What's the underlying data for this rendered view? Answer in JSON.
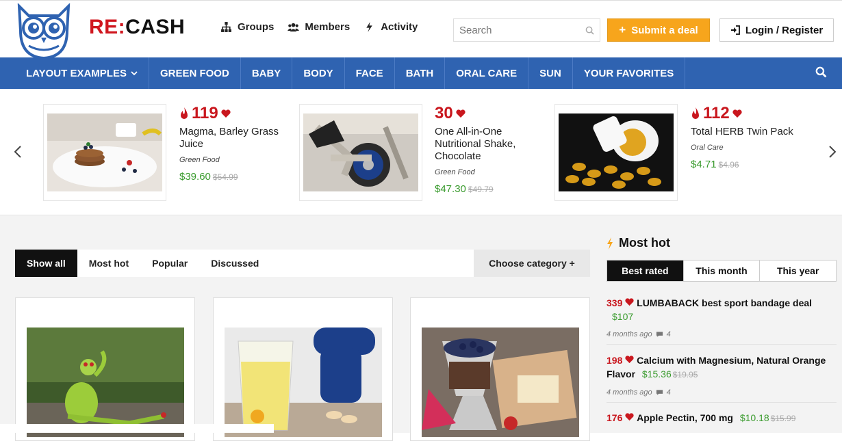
{
  "brand": {
    "re": "RE:",
    "cash": "CASH"
  },
  "topnav": [
    {
      "label": "Groups",
      "icon": "sitemap-icon"
    },
    {
      "label": "Members",
      "icon": "users-icon"
    },
    {
      "label": "Activity",
      "icon": "bolt-icon"
    }
  ],
  "search": {
    "placeholder": "Search"
  },
  "submit_label": "Submit a deal",
  "login_label": "Login / Register",
  "categories": [
    "LAYOUT EXAMPLES",
    "GREEN FOOD",
    "BABY",
    "BODY",
    "FACE",
    "BATH",
    "ORAL CARE",
    "SUN",
    "YOUR FAVORITES"
  ],
  "carousel": [
    {
      "score": "119",
      "name": "Magma, Barley Grass Juice",
      "category": "Green Food",
      "price": "$39.60",
      "old_price": "$54.99",
      "hot": true
    },
    {
      "score": "30",
      "name": "One All-in-One Nutritional Shake, Chocolate",
      "category": "Green Food",
      "price": "$47.30",
      "old_price": "$49.79",
      "hot": false
    },
    {
      "score": "112",
      "name": "Total HERB Twin Pack",
      "category": "Oral Care",
      "price": "$4.71",
      "old_price": "$4.96",
      "hot": true
    }
  ],
  "feed_tabs": [
    "Show all",
    "Most hot",
    "Popular",
    "Discussed"
  ],
  "choose_category": "Choose category +",
  "sidebar": {
    "title": "Most hot",
    "tabs": [
      "Best rated",
      "This month",
      "This year"
    ],
    "items": [
      {
        "score": "339",
        "title": "LUMBABACK best sport bandage deal",
        "price": "$107",
        "old_price": "",
        "time": "4 months ago",
        "comments": "4"
      },
      {
        "score": "198",
        "title": "Calcium with Magnesium, Natural Orange Flavor",
        "price": "$15.36",
        "old_price": "$19.95",
        "time": "4 months ago",
        "comments": "4"
      },
      {
        "score": "176",
        "title": "Apple Pectin, 700 mg",
        "price": "$10.18",
        "old_price": "$15.99",
        "time": "",
        "comments": ""
      }
    ]
  },
  "colors": {
    "brand_red": "#d0161e",
    "nav_blue": "#2f63b1",
    "accent_orange": "#f7a51c",
    "price_green": "#3a9b2e"
  }
}
